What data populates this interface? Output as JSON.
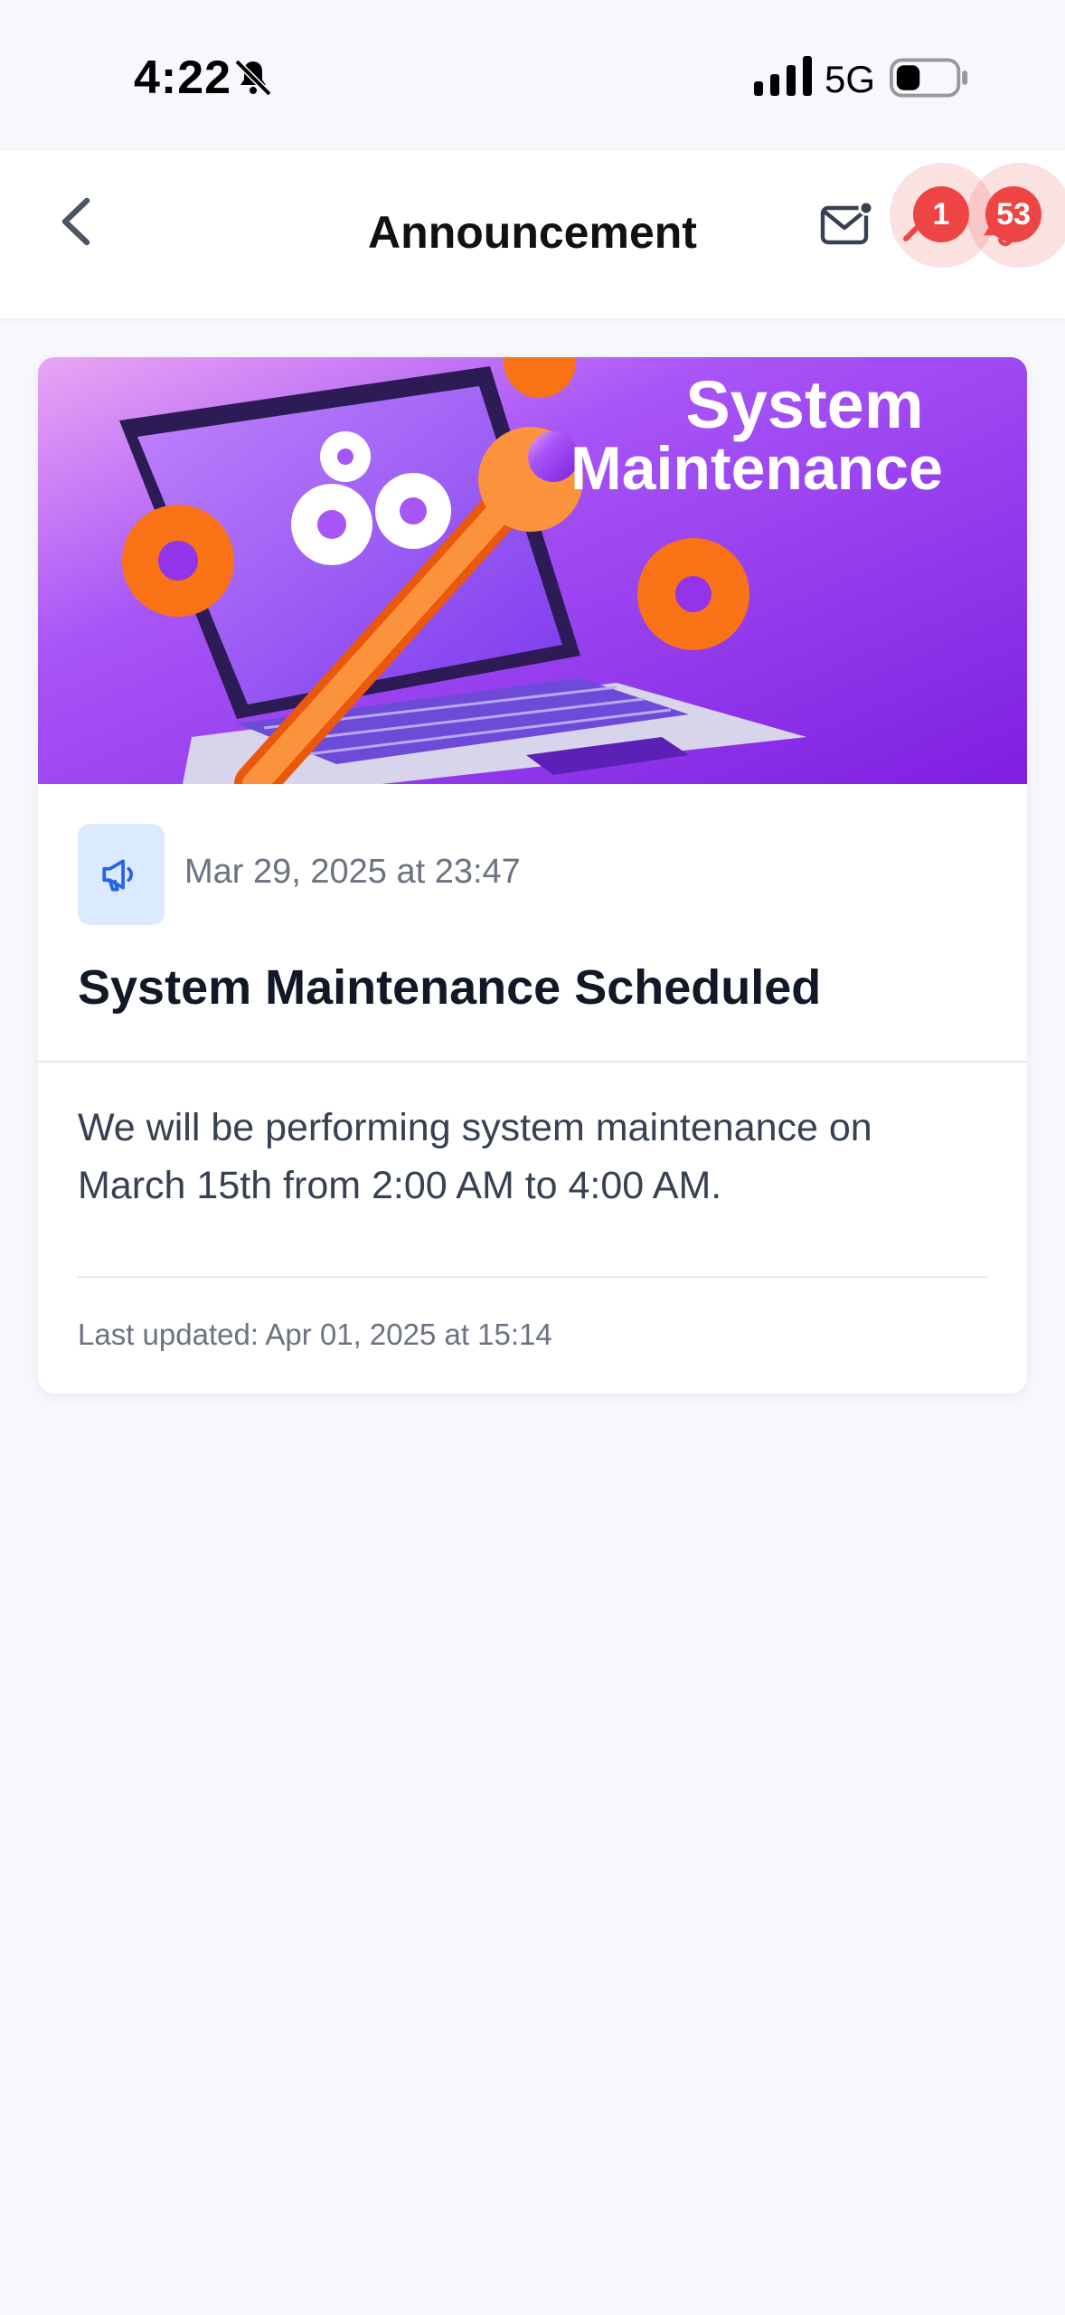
{
  "status_bar": {
    "time": "4:22",
    "network": "5G"
  },
  "header": {
    "title": "Announcement",
    "tools_badge": "1",
    "notifications_badge": "53"
  },
  "announcement": {
    "banner_line1": "System",
    "banner_line2": "Maintenance",
    "date": "Mar 29, 2025 at 23:47",
    "title": "System Maintenance Scheduled",
    "body": "We will be performing system maintenance on March 15th from 2:00 AM to 4:00 AM.",
    "last_updated": "Last updated: Apr 01, 2025 at 15:14"
  },
  "colors": {
    "accent": "#2563eb",
    "badge": "#ef4444",
    "banner_purple": "#8b2cf5",
    "banner_orange": "#f97316"
  }
}
